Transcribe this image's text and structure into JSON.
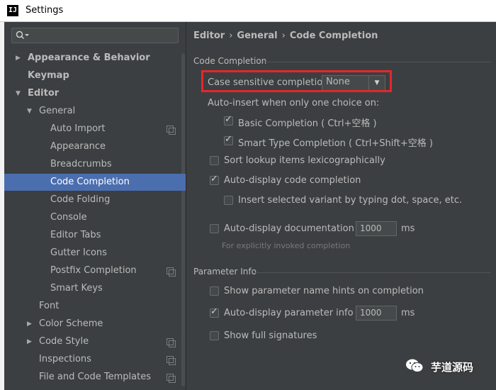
{
  "window": {
    "title": "Settings",
    "app_icon": "IJ"
  },
  "sidebar": {
    "search_value": "",
    "items": [
      {
        "label": "Appearance & Behavior",
        "arrow": "▶"
      },
      {
        "label": "Keymap",
        "arrow": ""
      },
      {
        "label": "Editor",
        "arrow": "▼"
      },
      {
        "label": "General",
        "arrow": "▼"
      },
      {
        "label": "Auto Import",
        "arrow": ""
      },
      {
        "label": "Appearance",
        "arrow": ""
      },
      {
        "label": "Breadcrumbs",
        "arrow": ""
      },
      {
        "label": "Code Completion",
        "arrow": ""
      },
      {
        "label": "Code Folding",
        "arrow": ""
      },
      {
        "label": "Console",
        "arrow": ""
      },
      {
        "label": "Editor Tabs",
        "arrow": ""
      },
      {
        "label": "Gutter Icons",
        "arrow": ""
      },
      {
        "label": "Postfix Completion",
        "arrow": ""
      },
      {
        "label": "Smart Keys",
        "arrow": ""
      },
      {
        "label": "Font",
        "arrow": ""
      },
      {
        "label": "Color Scheme",
        "arrow": "▶"
      },
      {
        "label": "Code Style",
        "arrow": "▶"
      },
      {
        "label": "Inspections",
        "arrow": ""
      },
      {
        "label": "File and Code Templates",
        "arrow": ""
      }
    ],
    "selected": "Code Completion"
  },
  "breadcrumb": {
    "part1": "Editor",
    "part2": "General",
    "part3": "Code Completion",
    "separator": "›"
  },
  "code_completion": {
    "section_title": "Code Completion",
    "case_sensitive_label": "Case sensitive completion:",
    "case_sensitive_value": "None",
    "auto_insert_label": "Auto-insert when only one choice on:",
    "basic_completion": {
      "label": "Basic Completion ( Ctrl+空格 )",
      "checked": true
    },
    "smart_type_completion": {
      "label": "Smart Type Completion ( Ctrl+Shift+空格 )",
      "checked": true
    },
    "sort_lexicographically": {
      "label": "Sort lookup items lexicographically",
      "checked": false
    },
    "auto_display_completion": {
      "label": "Auto-display code completion",
      "checked": true
    },
    "insert_selected_variant": {
      "label": "Insert selected variant by typing dot, space, etc.",
      "checked": false
    },
    "auto_display_documentation": {
      "label": "Auto-display documentation in",
      "checked": false,
      "value": "1000",
      "unit": "ms"
    },
    "documentation_hint": "For explicitly invoked completion"
  },
  "parameter_info": {
    "section_title": "Parameter Info",
    "show_name_hints": {
      "label": "Show parameter name hints on completion",
      "checked": false
    },
    "auto_display_info": {
      "label": "Auto-display parameter info in",
      "checked": true,
      "value": "1000",
      "unit": "ms"
    },
    "show_full_signatures": {
      "label": "Show full signatures",
      "checked": false
    }
  },
  "watermark": {
    "text": "芋道源码"
  },
  "colors": {
    "selection": "#4b6eaf",
    "highlight_box": "#e6262b",
    "background": "#3c3f41"
  }
}
